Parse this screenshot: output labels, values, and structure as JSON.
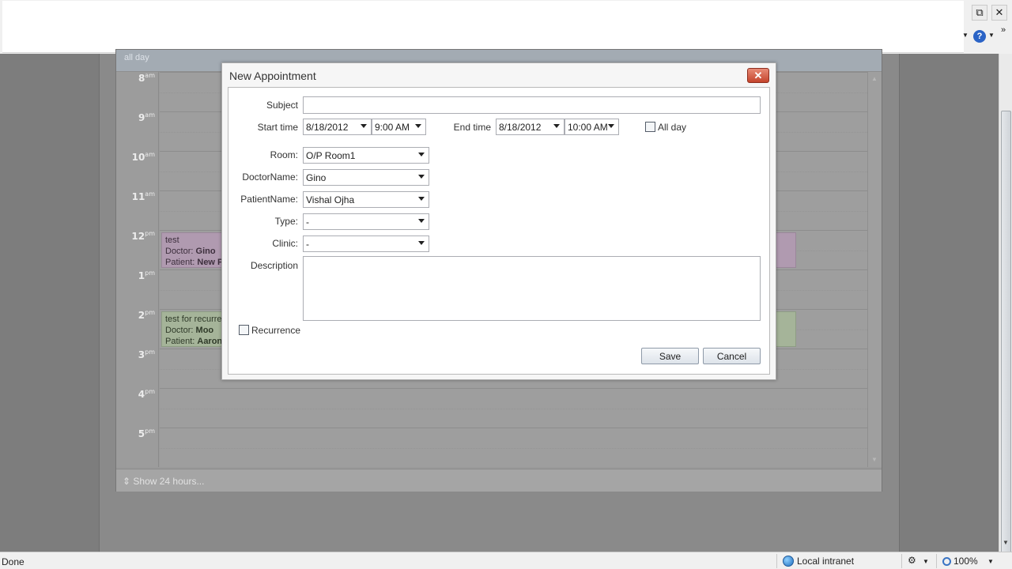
{
  "window": {
    "restore_glyph": "⧉",
    "close_glyph": "✕",
    "chevron_glyph": "»",
    "help_glyph": "?"
  },
  "scheduler": {
    "allday_label": "all day",
    "hours": [
      {
        "num": "8",
        "suffix": "am"
      },
      {
        "num": "9",
        "suffix": "am"
      },
      {
        "num": "10",
        "suffix": "am"
      },
      {
        "num": "11",
        "suffix": "am"
      },
      {
        "num": "12",
        "suffix": "pm"
      },
      {
        "num": "1",
        "suffix": "pm"
      },
      {
        "num": "2",
        "suffix": "pm"
      },
      {
        "num": "3",
        "suffix": "pm"
      },
      {
        "num": "4",
        "suffix": "pm"
      },
      {
        "num": "5",
        "suffix": "pm"
      }
    ],
    "appointments": [
      {
        "title": "test",
        "doctor_label": "Doctor:",
        "doctor": "Gino",
        "patient_label": "Patient:",
        "patient": "New P"
      },
      {
        "title": "test for recurre",
        "doctor_label": "Doctor:",
        "doctor": "Moo",
        "patient_label": "Patient:",
        "patient": "Aaron"
      }
    ],
    "footer_link": "Show 24 hours..."
  },
  "dialog": {
    "title": "New Appointment",
    "close_glyph": "✕",
    "subject": {
      "label": "Subject",
      "value": ""
    },
    "start_time": {
      "label": "Start time",
      "date": "8/18/2012",
      "time": "9:00 AM"
    },
    "end_time": {
      "label": "End time",
      "date": "8/18/2012",
      "time": "10:00 AM"
    },
    "all_day": {
      "label": "All day",
      "checked": false
    },
    "room": {
      "label": "Room:",
      "value": "O/P Room1"
    },
    "doctor": {
      "label": "DoctorName:",
      "value": "Gino"
    },
    "patient": {
      "label": "PatientName:",
      "value": "Vishal Ojha"
    },
    "type": {
      "label": "Type:",
      "value": "-"
    },
    "clinic": {
      "label": "Clinic:",
      "value": "-"
    },
    "description": {
      "label": "Description",
      "value": ""
    },
    "recurrence": {
      "label": "Recurrence",
      "checked": false
    },
    "save_label": "Save",
    "cancel_label": "Cancel"
  },
  "statusbar": {
    "status": "Done",
    "zone": "Local intranet",
    "zoom": "100%"
  }
}
